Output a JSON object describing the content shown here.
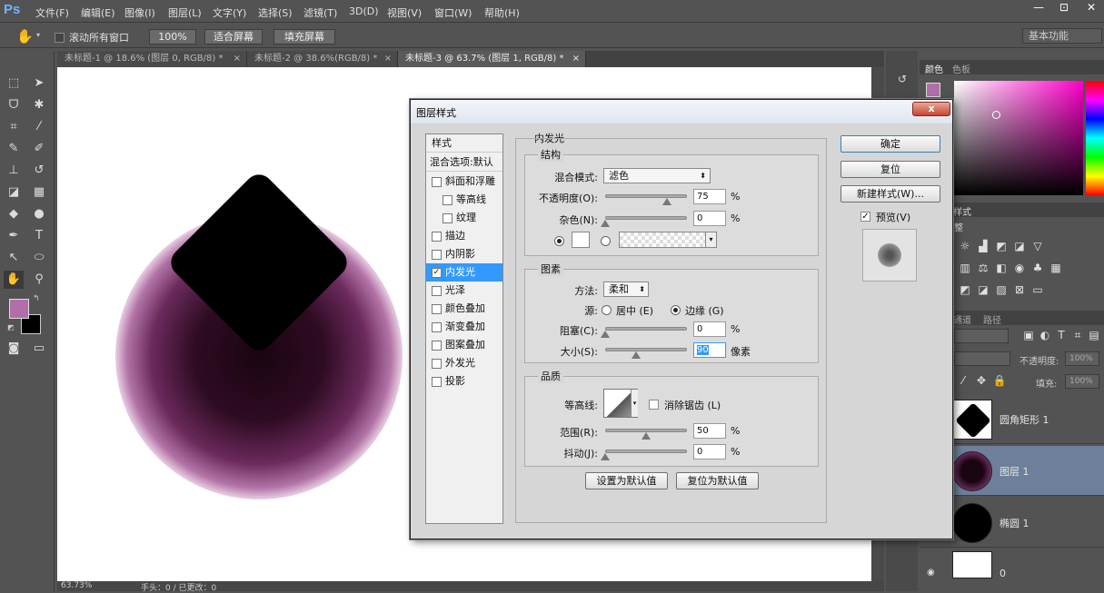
{
  "app": {
    "logo": "Ps"
  },
  "menu": [
    "文件(F)",
    "编辑(E)",
    "图像(I)",
    "图层(L)",
    "文字(Y)",
    "选择(S)",
    "滤镜(T)",
    "3D(D)",
    "视图(V)",
    "窗口(W)",
    "帮助(H)"
  ],
  "window_buttons": [
    "—",
    "⊡",
    "✕"
  ],
  "options": {
    "scroll_all": "滚动所有窗口",
    "zoom": "100%",
    "fit_screen": "适合屏幕",
    "fill_screen": "填充屏幕",
    "workspace": "基本功能"
  },
  "tabs": [
    {
      "label": "未标题-1 @ 18.6% (图层 0, RGB/8) *",
      "close": "×"
    },
    {
      "label": "未标题-2 @ 38.6%(RGB/8) *",
      "close": "×"
    },
    {
      "label": "未标题-3 @ 63.7% (图层 1, RGB/8) *",
      "close": "×"
    }
  ],
  "status": {
    "zoom": "63.73%",
    "doc": "手头：0 / 已更改：0"
  },
  "colors": {
    "foreground": "#b06fa8",
    "background": "#000000",
    "accent": "#3399ff"
  },
  "dialog": {
    "title": "图层样式",
    "close": "x",
    "styles_header": "样式",
    "blend_default": "混合选项:默认",
    "styles": [
      {
        "label": "斜面和浮雕",
        "checked": false,
        "indent": false
      },
      {
        "label": "等高线",
        "checked": false,
        "indent": true
      },
      {
        "label": "纹理",
        "checked": false,
        "indent": true
      },
      {
        "label": "描边",
        "checked": false,
        "indent": false
      },
      {
        "label": "内阴影",
        "checked": false,
        "indent": false
      },
      {
        "label": "内发光",
        "checked": true,
        "indent": false,
        "selected": true
      },
      {
        "label": "光泽",
        "checked": false,
        "indent": false
      },
      {
        "label": "颜色叠加",
        "checked": false,
        "indent": false
      },
      {
        "label": "渐变叠加",
        "checked": false,
        "indent": false
      },
      {
        "label": "图案叠加",
        "checked": false,
        "indent": false
      },
      {
        "label": "外发光",
        "checked": false,
        "indent": false
      },
      {
        "label": "投影",
        "checked": false,
        "indent": false
      }
    ],
    "section_title": "内发光",
    "structure": {
      "title": "结构",
      "blend_mode_label": "混合模式:",
      "blend_mode": "滤色",
      "opacity_label": "不透明度(O):",
      "opacity": "75",
      "opacity_pct": 0.75,
      "noise_label": "杂色(N):",
      "noise": "0",
      "noise_pct": 0
    },
    "elements": {
      "title": "图素",
      "method_label": "方法:",
      "method": "柔和",
      "source_label": "源:",
      "center": "居中 (E)",
      "edge": "边缘 (G)",
      "choke_label": "阻塞(C):",
      "choke": "0",
      "choke_pct": 0,
      "size_label": "大小(S):",
      "size": "90",
      "size_frac": 0.38,
      "size_unit": "像素"
    },
    "quality": {
      "title": "品质",
      "contour_label": "等高线:",
      "antialias": "消除锯齿 (L)",
      "range_label": "范围(R):",
      "range": "50",
      "range_pct": 0.5,
      "jitter_label": "抖动(J):",
      "jitter": "0",
      "jitter_pct": 0
    },
    "pct": "%",
    "make_default": "设置为默认值",
    "reset_default": "复位为默认值",
    "ok": "确定",
    "reset": "复位",
    "new_style": "新建样式(W)...",
    "preview": "预览(V)"
  },
  "panels": {
    "color_tab": "颜色",
    "swatches_tab": "色板",
    "styles_tab": "样式",
    "adjust_tab": "整",
    "channels_tab": "通道",
    "paths_tab": "路径",
    "opacity_label": "不透明度:",
    "opacity_value": "100%",
    "fill_label": "填充:",
    "fill_value": "100%",
    "layers": [
      {
        "name": "圆角矩形 1",
        "selected": false
      },
      {
        "name": "图层 1",
        "selected": true
      },
      {
        "name": "椭圆 1",
        "selected": false
      },
      {
        "name": "0",
        "selected": false
      }
    ]
  }
}
